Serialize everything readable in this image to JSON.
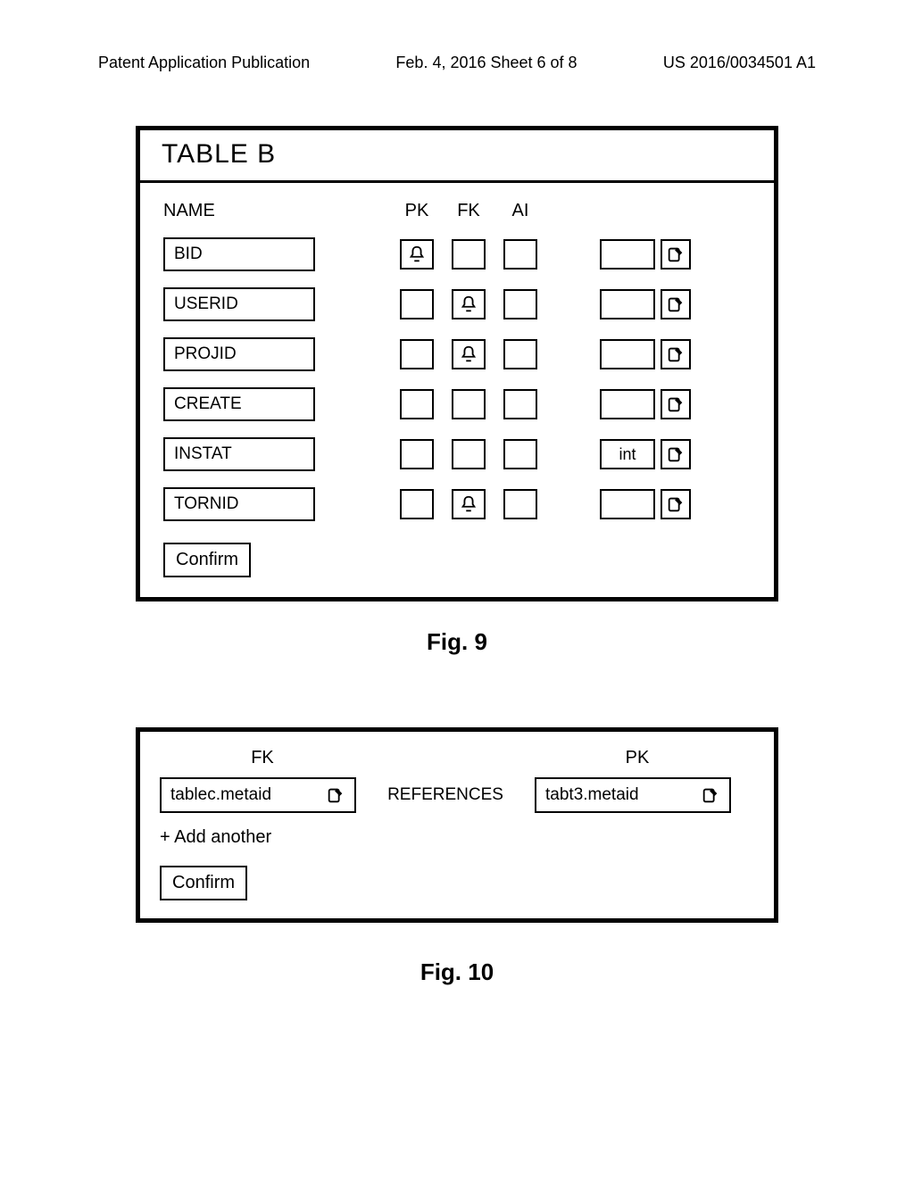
{
  "header": {
    "left": "Patent Application Publication",
    "center": "Feb. 4, 2016   Sheet 6 of 8",
    "right": "US 2016/0034501 A1"
  },
  "fig9": {
    "title": "TABLE B",
    "cols": {
      "name": "NAME",
      "pk": "PK",
      "fk": "FK",
      "ai": "AI"
    },
    "rows": [
      {
        "name": "BID",
        "pk": true,
        "fk": false,
        "ai": false,
        "type": ""
      },
      {
        "name": "USERID",
        "pk": false,
        "fk": true,
        "ai": false,
        "type": ""
      },
      {
        "name": "PROJID",
        "pk": false,
        "fk": true,
        "ai": false,
        "type": ""
      },
      {
        "name": "CREATE",
        "pk": false,
        "fk": false,
        "ai": false,
        "type": ""
      },
      {
        "name": "INSTAT",
        "pk": false,
        "fk": false,
        "ai": false,
        "type": "int"
      },
      {
        "name": "TORNID",
        "pk": false,
        "fk": true,
        "ai": false,
        "type": ""
      }
    ],
    "confirm": "Confirm",
    "caption": "Fig. 9"
  },
  "fig10": {
    "fk_label": "FK",
    "pk_label": "PK",
    "references": "REFERENCES",
    "fk_value": "tablec.metaid",
    "pk_value": "tabt3.metaid",
    "add_another": "+ Add another",
    "confirm": "Confirm",
    "caption": "Fig. 10"
  }
}
